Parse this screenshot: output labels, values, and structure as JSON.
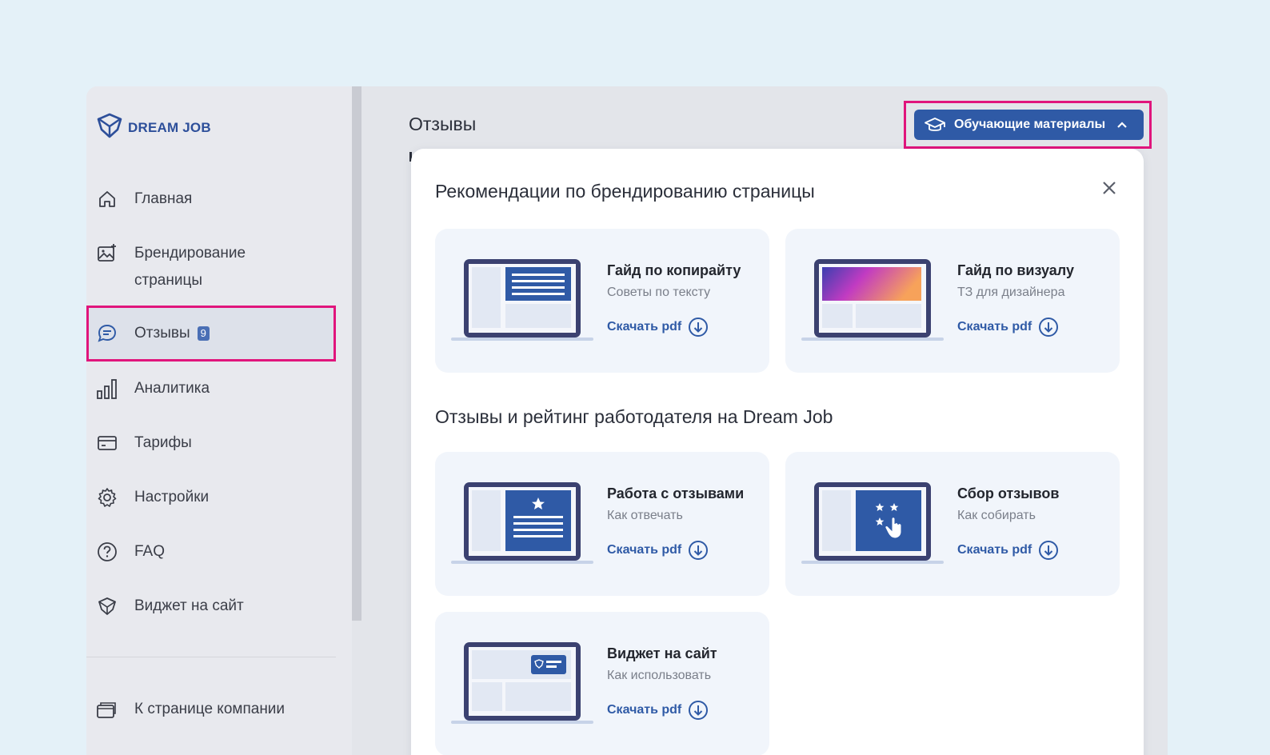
{
  "brand": {
    "name": "DREAM JOB",
    "accent": "#2f5aa6",
    "highlight": "#e0157c"
  },
  "sidebar": {
    "items": [
      {
        "label": "Главная",
        "icon": "home-icon"
      },
      {
        "label": "Брендирование",
        "label2": "страницы",
        "icon": "image-plus-icon"
      },
      {
        "label": "Отзывы",
        "badge": "9",
        "icon": "chat-icon"
      },
      {
        "label": "Аналитика",
        "icon": "bar-chart-icon"
      },
      {
        "label": "Тарифы",
        "icon": "card-icon"
      },
      {
        "label": "Настройки",
        "icon": "gear-icon"
      },
      {
        "label": "FAQ",
        "icon": "question-icon"
      },
      {
        "label": "Виджет на сайт",
        "icon": "diamond-icon"
      }
    ],
    "company_link": "К странице компании"
  },
  "header": {
    "title": "Отзывы",
    "edu_button": "Обучающие материалы"
  },
  "panel": {
    "sections": [
      {
        "title": "Рекомендации по брендированию страницы",
        "cards": [
          {
            "title": "Гайд по копирайту",
            "subtitle": "Советы по тексту",
            "link": "Скачать pdf"
          },
          {
            "title": "Гайд по визуалу",
            "subtitle": "ТЗ для дизайнера",
            "link": "Скачать pdf"
          }
        ]
      },
      {
        "title": "Отзывы и рейтинг работодателя на Dream Job",
        "cards": [
          {
            "title": "Работа с отзывами",
            "subtitle": "Как отвечать",
            "link": "Скачать pdf"
          },
          {
            "title": "Сбор отзывов",
            "subtitle": "Как собирать",
            "link": "Скачать pdf"
          },
          {
            "title": "Виджет на сайт",
            "subtitle": "Как использовать",
            "link": "Скачать pdf"
          }
        ]
      }
    ]
  }
}
